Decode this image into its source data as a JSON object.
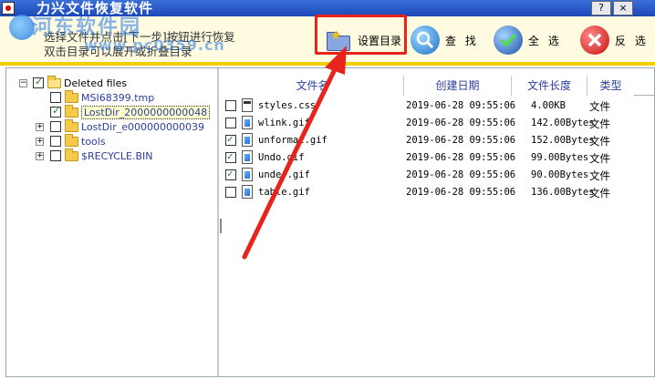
{
  "window": {
    "title": "力兴文件恢复软件",
    "help_label": "?",
    "close_label": "×"
  },
  "header": {
    "hint_line1": "选择文件并点击[下一步]按钮进行恢复",
    "hint_line2": "双击目录可以展开或折叠目录"
  },
  "watermark": {
    "line1": "河东软件园",
    "line2": "www.pc0359.cn"
  },
  "toolbar": {
    "set_dir_label": "设置目录",
    "find_label": "查 找",
    "select_all_label": "全 选",
    "invert_label": "反 选"
  },
  "tree": {
    "root": "Deleted files",
    "items": [
      {
        "label": "MSI68399.tmp"
      },
      {
        "label": "LostDir_2000000000048"
      },
      {
        "label": "LostDir_e000000000039"
      },
      {
        "label": "tools"
      },
      {
        "label": "$RECYCLE.BIN"
      }
    ]
  },
  "file_list": {
    "columns": [
      "文件名",
      "创建日期",
      "文件长度",
      "类型"
    ],
    "rows": [
      {
        "name": "styles.css",
        "date": "2019-06-28 09:55:06",
        "size": "4.00KB",
        "type": "文件",
        "checked": false,
        "icon": "css-file-icon"
      },
      {
        "name": "wlink.gif",
        "date": "2019-06-28 09:55:06",
        "size": "142.00Bytes",
        "type": "文件",
        "checked": false,
        "icon": "image-file-icon"
      },
      {
        "name": "unformat.gif",
        "date": "2019-06-28 09:55:06",
        "size": "152.00Bytes",
        "type": "文件",
        "checked": true,
        "icon": "image-file-icon"
      },
      {
        "name": "Undo.gif",
        "date": "2019-06-28 09:55:06",
        "size": "99.00Bytes",
        "type": "文件",
        "checked": true,
        "icon": "image-file-icon"
      },
      {
        "name": "under.gif",
        "date": "2019-06-28 09:55:06",
        "size": "90.00Bytes",
        "type": "文件",
        "checked": true,
        "icon": "image-file-icon"
      },
      {
        "name": "table.gif",
        "date": "2019-06-28 09:55:06",
        "size": "136.00Bytes",
        "type": "文件",
        "checked": false,
        "icon": "image-file-icon"
      }
    ]
  },
  "colors": {
    "accent_highlight": "#e8231c",
    "header_bg": "#fffbe0",
    "separator": "#f0d000",
    "titlebar": "#1c48b8"
  }
}
